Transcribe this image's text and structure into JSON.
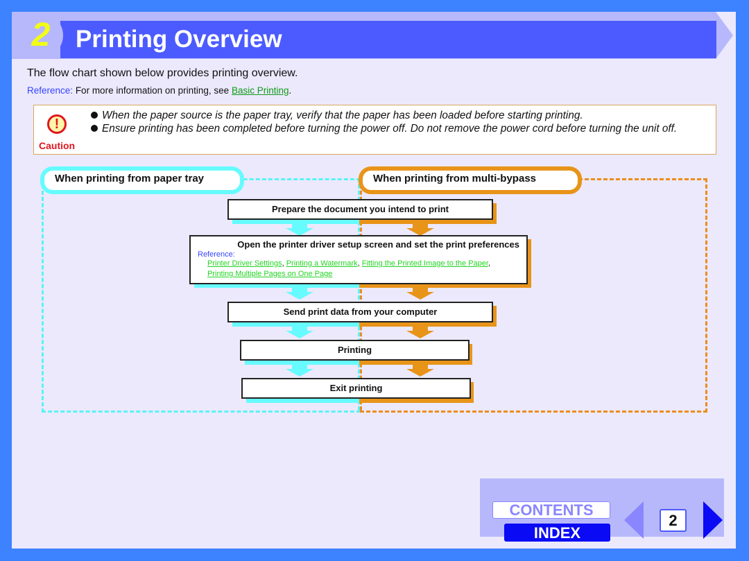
{
  "header": {
    "chapter_number": "2",
    "title": "Printing Overview"
  },
  "intro": "The flow chart shown below provides printing overview.",
  "reference": {
    "label": "Reference:",
    "text": "For more information on printing, see",
    "link": "Basic Printing",
    "trailing": "."
  },
  "caution": {
    "icon": "exclamation-icon",
    "label": "Caution",
    "items": [
      "When the paper source is the paper tray, verify that the paper has been loaded before starting printing.",
      "Ensure printing has been completed before turning the power off. Do not remove the power cord before turning the unit off."
    ]
  },
  "flow": {
    "paper_tray_label": "When printing from paper tray",
    "multi_bypass_label": "When printing from multi-bypass",
    "colors": {
      "paper_tray": "#66fbfe",
      "multi_bypass": "#e89419"
    },
    "steps": [
      {
        "title": "Prepare the document you intend to print"
      },
      {
        "title": "Open the printer driver setup screen and set the print preferences",
        "reference_label": "Reference:",
        "links": [
          "Printer Driver Settings",
          "Printing a Watermark",
          "Fitting the Printed Image to the Paper",
          "Printing Multiple Pages on One Page"
        ]
      },
      {
        "title": "Send print data from your computer"
      },
      {
        "title": "Printing"
      },
      {
        "title": "Exit printing"
      }
    ]
  },
  "nav": {
    "contents_label": "CONTENTS",
    "index_label": "INDEX",
    "page_number": "2",
    "prev_icon": "triangle-left-icon",
    "next_icon": "triangle-right-icon"
  }
}
